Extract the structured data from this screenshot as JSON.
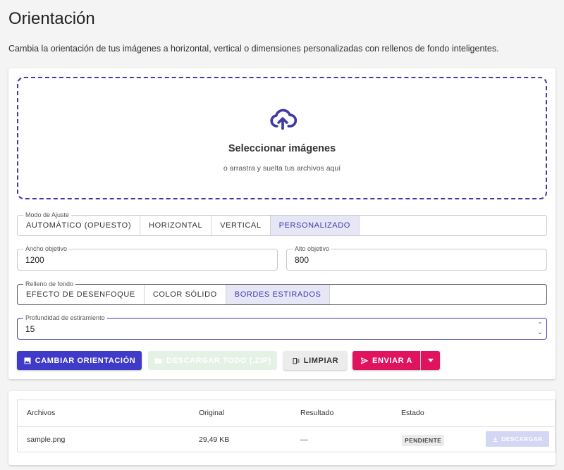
{
  "header": {
    "title": "Orientación",
    "description": "Cambia la orientación de tus imágenes a horizontal, vertical o dimensiones personalizadas con rellenos de fondo inteligentes."
  },
  "dropzone": {
    "title": "Seleccionar imágenes",
    "subtitle": "o arrastra y suelta tus archivos aquí",
    "icon": "cloud-upload-icon"
  },
  "fit_mode": {
    "legend": "Modo de Ajuste",
    "options": [
      "AUTOMÁTICO (OPUESTO)",
      "HORIZONTAL",
      "VERTICAL",
      "PERSONALIZADO"
    ],
    "selected": "PERSONALIZADO"
  },
  "width_field": {
    "legend": "Ancho objetivo",
    "value": "1200"
  },
  "height_field": {
    "legend": "Alto objetivo",
    "value": "800"
  },
  "background_fill": {
    "legend": "Relleno de fondo",
    "options": [
      "EFECTO DE DESENFOQUE",
      "COLOR SÓLIDO",
      "BORDES ESTIRADOS"
    ],
    "selected": "BORDES ESTIRADOS"
  },
  "stretch_depth": {
    "legend": "Profundidad de estiramiento",
    "value": "15"
  },
  "actions": {
    "change": "CAMBIAR ORIENTACIÓN",
    "download_all": "DESCARGAR TODO (.ZIP)",
    "clear": "LIMPIAR",
    "send": "ENVIAR A"
  },
  "table": {
    "headers": [
      "Archivos",
      "Original",
      "Resultado",
      "Estado"
    ],
    "rows": [
      {
        "file": "sample.png",
        "original": "29,49 KB",
        "result": "—",
        "status": "PENDIENTE",
        "action": "DESCARGAR"
      }
    ]
  },
  "colors": {
    "primary": "#3f3ac8",
    "accent": "#e0145e",
    "selected_bg": "#e6e6f7"
  }
}
